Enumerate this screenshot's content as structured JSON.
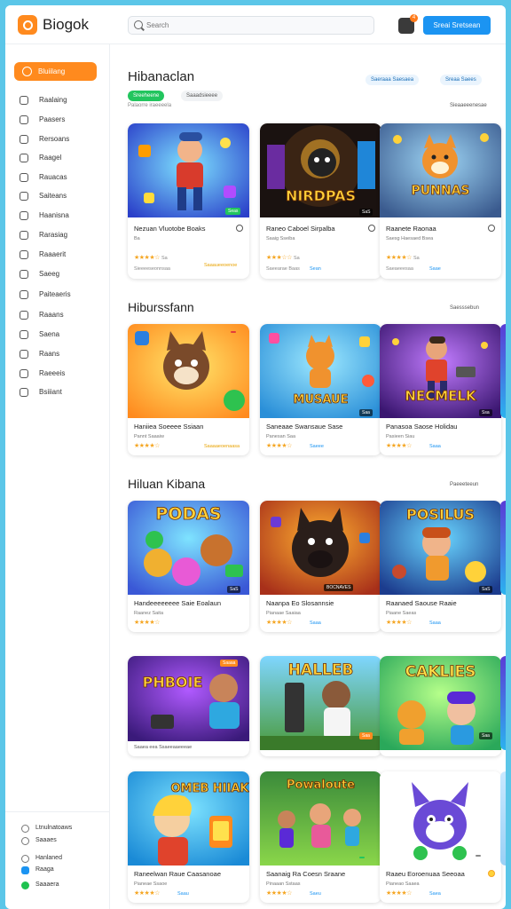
{
  "app": {
    "brand": "Biogok"
  },
  "search": {
    "placeholder": "Search"
  },
  "header": {
    "notif_count": "4",
    "cta_label": "Sreai Sretsean"
  },
  "sidebar": {
    "active": "Bluiilang",
    "items": [
      "Raalaing",
      "Paasers",
      "Rersoans",
      "Raagel",
      "Rauacas",
      "Saiteans",
      "Haanisna",
      "Rarasiag",
      "Raaaerit",
      "Saeeg",
      "Paiteaeris",
      "Raaans",
      "Saena",
      "Raans",
      "Raeeeis",
      "Bsiiiant"
    ],
    "bottom": [
      "Ltnulnatoaws",
      "Saaaes",
      "Hanlaned",
      "Raaga",
      "Saaaera"
    ]
  },
  "featured": {
    "title": "Hibanaclan",
    "chips": [
      "Sreeheene",
      "Saaadsieeee"
    ],
    "subtitle": "Palaorre iraeeeela",
    "pills": [
      "Saeraaa Saesaea",
      "Sreaa Saees"
    ],
    "view_all": "Sieaaeeenesae"
  },
  "sections": [
    {
      "title": "Hiburssfann",
      "view_all": "Saesssebun"
    },
    {
      "title": "Hiluan Kibana",
      "view_all": "Paeeeteeun"
    }
  ],
  "cards": [
    {
      "title": "Nezuan Vluotobe Boaks",
      "meta": "Ba",
      "rating": "Sa",
      "players": "Sieeeeseonnsaa",
      "action": "Saaaueeoenoe",
      "badge": "Seas",
      "overlay": ""
    },
    {
      "title": "Raneo Caboel Sirpalba",
      "meta": "Saaig Sseiba",
      "rating": "Sa",
      "players": "Saeearae Baas",
      "action": "Sean",
      "badge": "SaS",
      "overlay": "NIRDPAS"
    },
    {
      "title": "Raanete Raonaa",
      "meta": "Saesg Haesaed Bsea",
      "rating": "Sa",
      "players": "Saeaeeesaa",
      "action": "Saae",
      "badge": "",
      "overlay": "PUNNAS"
    },
    {
      "title": "Haniiea Soeeee Ssiaan",
      "meta": "Pannt Saaaiw",
      "rating": "",
      "players": "",
      "action": "Saaaaeoenaasa",
      "badge": "Saas",
      "overlay": ""
    },
    {
      "title": "Saneaae Swansaue Sase",
      "meta": "Panesan Saa",
      "rating": "",
      "players": "",
      "action": "Saeee",
      "badge": "Saa",
      "overlay": "MUSAUE"
    },
    {
      "title": "Panasoa Saose Holidau",
      "meta": "Pasieen Siau",
      "rating": "",
      "players": "",
      "action": "Saaa",
      "badge": "Ssa",
      "overlay": "NECMELK"
    },
    {
      "title": "Handeeeeeeee Saie Eoalaun",
      "meta": "Raanez Saita",
      "rating": "",
      "players": "",
      "action": "",
      "badge": "SaS",
      "overlay": "PODAS"
    },
    {
      "title": "Naanpa Eo Slosannsie",
      "meta": "Pianaae Saaiaa",
      "rating": "",
      "players": "",
      "action": "Saaa",
      "badge": "BOCNAVES",
      "overlay": ""
    },
    {
      "title": "Raanaed Saouse Raaie",
      "meta": "Piaane Saeas",
      "rating": "",
      "players": "",
      "action": "Saaa",
      "badge": "SaS",
      "overlay": "POSILUS"
    },
    {
      "title": "Saaea eea Ssaeeaaeeeae",
      "meta": "",
      "rating": "",
      "players": "",
      "action": "",
      "badge": "Saaaa",
      "overlay": "PHBOIE"
    },
    {
      "title": "",
      "meta": "",
      "rating": "",
      "players": "",
      "action": "",
      "badge": "Saa",
      "overlay": "HALLEB"
    },
    {
      "title": "",
      "meta": "",
      "rating": "",
      "players": "",
      "action": "",
      "badge": "Saa",
      "overlay": "CAKLIES"
    },
    {
      "title": "Raneelwan Raue Caasanoae",
      "meta": "Pianeae Ssaoe",
      "rating": "",
      "players": "",
      "action": "Saau",
      "badge": "",
      "overlay": "OMEB HIIAK"
    },
    {
      "title": "Saanaig Ra Coesn Sraane",
      "meta": "Pinaaan Sstaas",
      "rating": "",
      "players": "",
      "action": "Saeu",
      "badge": "",
      "overlay": "Powaloute"
    },
    {
      "title": "Raaeu Eoroenuaa Seeoaa",
      "meta": "Pianeao Saaea",
      "rating": "",
      "players": "",
      "action": "Saea",
      "badge": "",
      "overlay": ""
    }
  ],
  "colors": {
    "accent": "#ff8a1e",
    "primary": "#1b94f2",
    "star": "#f5a623",
    "page_bg": "#5bc6e8"
  }
}
